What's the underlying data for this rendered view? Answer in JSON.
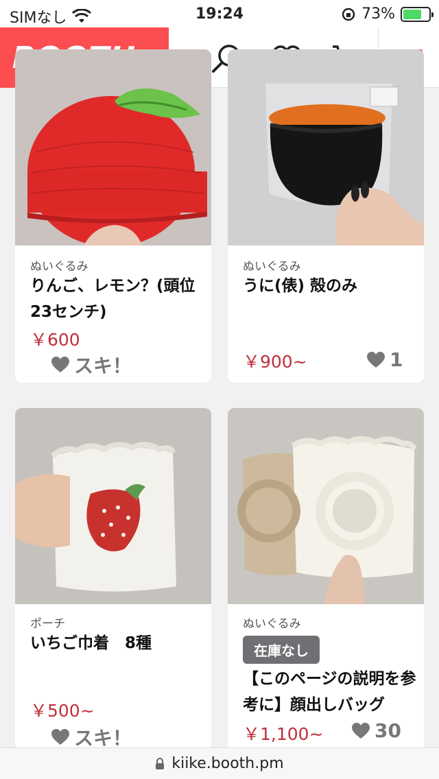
{
  "status_bar": {
    "carrier": "SIMなし",
    "time": "19:24",
    "battery_percent": "73%",
    "battery_level": 0.73
  },
  "header": {
    "logo_text": "BOOTH",
    "accent_color": "#fc4d50"
  },
  "products": [
    {
      "category": "ぬいぐるみ",
      "title": "りんご、レモン？(頭位23センチ)",
      "price": "￥600",
      "like_label": "スキ！"
    },
    {
      "category": "ぬいぐるみ",
      "title": "うに(俵) 殻のみ",
      "price": "￥900~",
      "like_count": "1"
    },
    {
      "category": "ポーチ",
      "title": "いちご巾着　8種",
      "price": "￥500~",
      "like_label": "スキ！"
    },
    {
      "category": "ぬいぐるみ",
      "badge": "在庫なし",
      "title": "【このページの説明を参考に】顔出しバッグ",
      "price": "￥1,100~",
      "like_count": "30"
    }
  ],
  "url_bar": {
    "url": "kiike.booth.pm"
  }
}
